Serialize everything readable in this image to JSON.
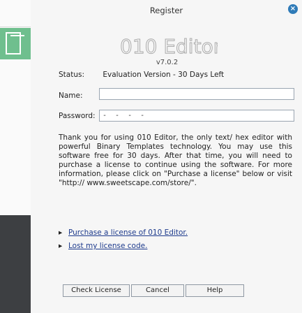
{
  "window": {
    "title": "Register",
    "close_glyph": "×"
  },
  "app": {
    "logo_text": "010 Editor",
    "version": "v7.0.2"
  },
  "status": {
    "label": "Status:",
    "value": "Evaluation Version - 30 Days Left"
  },
  "form": {
    "name_label": "Name:",
    "name_value": "",
    "password_label": "Password:",
    "password_value": "-  -  -  -"
  },
  "description": "Thank you for using 010 Editor, the only text/ hex editor with powerful Binary Templates technology. You may use this software free for 30 days. After that time, you will need to purchase a license to continue using the software. For more information, please click on \"Purchase a license\" below or visit \"http:// www.sweetscape.com/store/\".",
  "links": {
    "bullet": "▸",
    "purchase": "Purchase a license of 010 Editor.",
    "lost": "Lost my license code."
  },
  "buttons": {
    "check": "Check License",
    "cancel": "Cancel",
    "help": "Help"
  },
  "colors": {
    "accent_green": "#6fbf8e",
    "dark_panel": "#3d3f42",
    "close_button": "#2f7bb8"
  }
}
